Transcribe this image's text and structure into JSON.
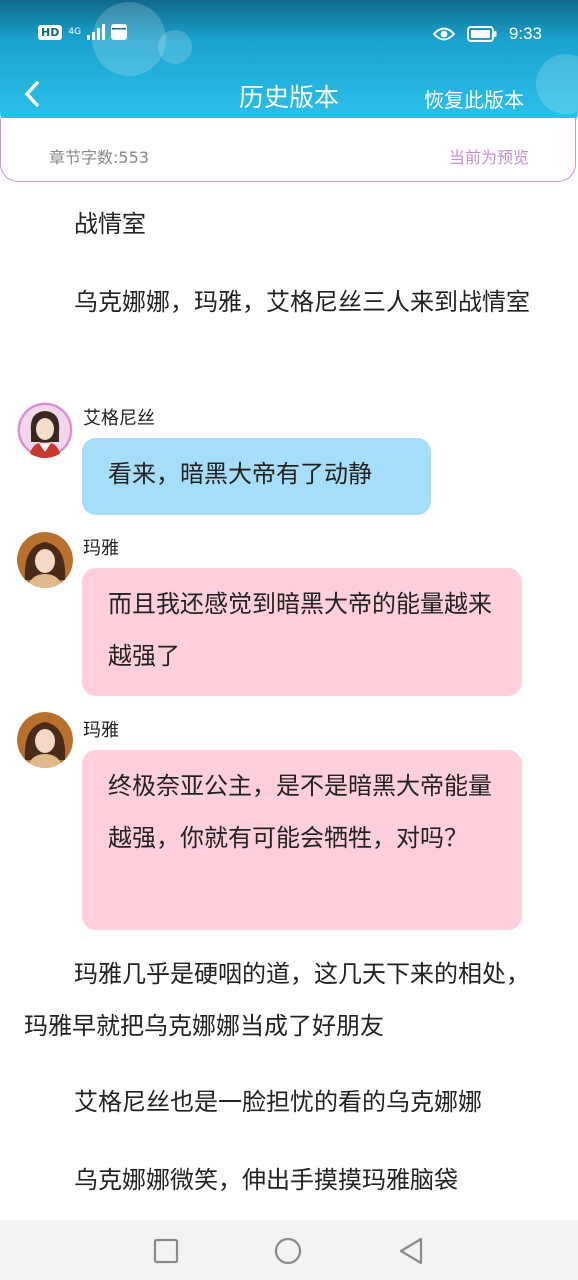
{
  "status_bar": {
    "hd": "HD",
    "network": "4G",
    "time": "9:33",
    "icons": [
      "signal-icon",
      "calendar-icon",
      "eye-icon",
      "battery-icon"
    ]
  },
  "header": {
    "title": "历史版本",
    "restore_label": "恢复此版本",
    "back_icon": "chevron-left-icon"
  },
  "info": {
    "word_count": "章节字数:553",
    "preview_label": "当前为预览"
  },
  "content": {
    "para_1": "战情室",
    "para_2": "乌克娜娜，玛雅，艾格尼丝三人来到战情室",
    "messages": [
      {
        "name": "艾格尼丝",
        "text": "看来，暗黑大帝有了动静",
        "color": "#a6ddf8"
      },
      {
        "name": "玛雅",
        "text": "而且我还感觉到暗黑大帝的能量越来越强了",
        "color": "#ffd0db"
      },
      {
        "name": "玛雅",
        "text": "终极奈亚公主，是不是暗黑大帝能量越强，你就有可能会牺牲，对吗？",
        "color": "#ffd0db"
      }
    ],
    "para_3": "玛雅几乎是硬咽的道，这几天下来的相处，玛雅早就把乌克娜娜当成了好朋友",
    "para_4": "艾格尼丝也是一脸担忧的看的乌克娜娜",
    "para_5": "乌克娜娜微笑，伸出手摸摸玛雅脑袋"
  },
  "nav": {
    "icons": [
      "recent-apps-icon",
      "home-icon",
      "back-icon"
    ]
  },
  "colors": {
    "header_gradient_top": "#0f6a8a",
    "header_gradient_bottom": "#2ec3ef",
    "card_border": "#c998d8",
    "preview_text": "#c98fd6"
  }
}
